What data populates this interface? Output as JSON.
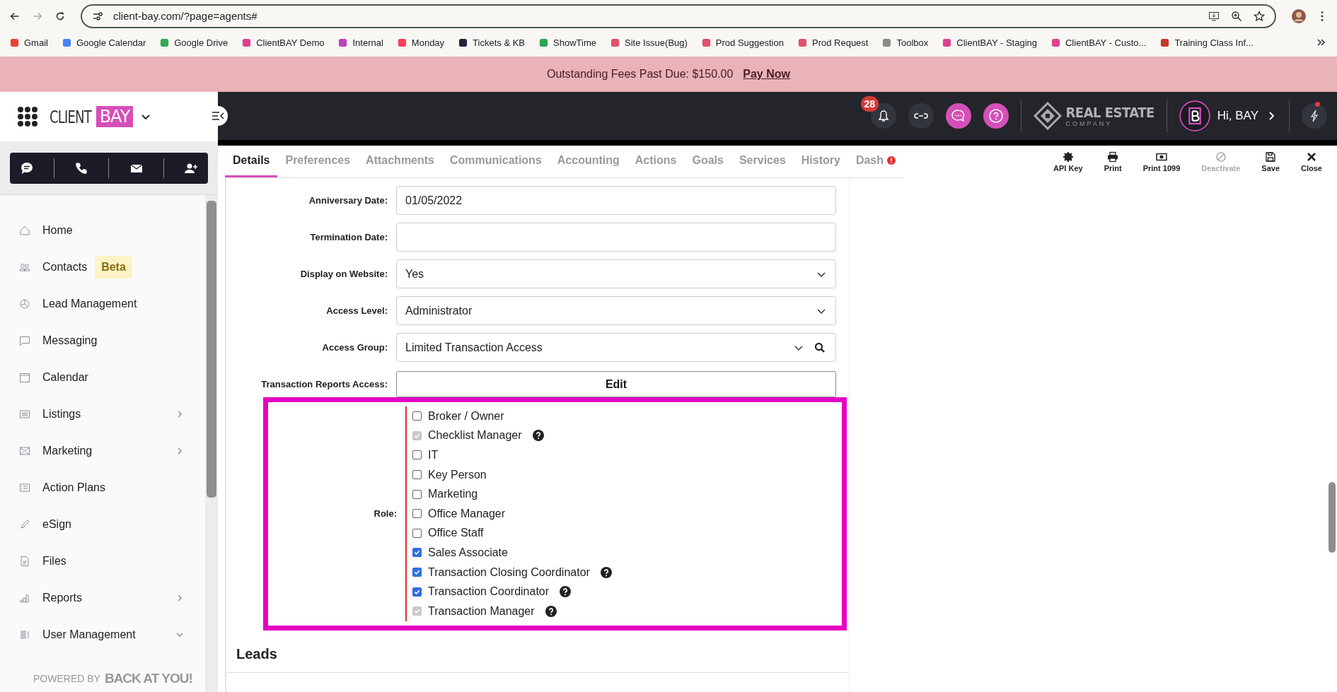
{
  "browser": {
    "url": "client-bay.com/?page=agents#",
    "bookmarks": [
      {
        "label": "Gmail",
        "color": "#ea4335"
      },
      {
        "label": "Google Calendar",
        "color": "#4285f4"
      },
      {
        "label": "Google Drive",
        "color": "#34a853"
      },
      {
        "label": "ClientBAY Demo",
        "color": "#e0408f"
      },
      {
        "label": "Internal",
        "color": "#c040c0"
      },
      {
        "label": "Monday",
        "color": "#ff3d57"
      },
      {
        "label": "Tickets & KB",
        "color": "#2a1f3d"
      },
      {
        "label": "ShowTime",
        "color": "#2ea44f"
      },
      {
        "label": "Site Issue(Bug)",
        "color": "#e0506a"
      },
      {
        "label": "Prod Suggestion",
        "color": "#e0506a"
      },
      {
        "label": "Prod Request",
        "color": "#e0506a"
      },
      {
        "label": "Toolbox",
        "color": "#8a8a8a"
      },
      {
        "label": "ClientBAY - Staging",
        "color": "#e0408f"
      },
      {
        "label": "ClientBAY - Custo...",
        "color": "#e0408f"
      },
      {
        "label": "Training Class Inf...",
        "color": "#c0392b"
      }
    ]
  },
  "banner": {
    "message": "Outstanding Fees Past Due: $150.00",
    "link": "Pay Now"
  },
  "logo": {
    "left": "CLIENT",
    "right": "BAY"
  },
  "sidebar": {
    "items": [
      {
        "label": "Home",
        "kind": "link"
      },
      {
        "label": "Contacts",
        "kind": "link",
        "badge": "Beta"
      },
      {
        "label": "Lead Management",
        "kind": "link"
      },
      {
        "label": "Messaging",
        "kind": "link"
      },
      {
        "label": "Calendar",
        "kind": "link"
      },
      {
        "label": "Listings",
        "kind": "group",
        "expanded": false
      },
      {
        "label": "Marketing",
        "kind": "group",
        "expanded": false
      },
      {
        "label": "Action Plans",
        "kind": "link"
      },
      {
        "label": "eSign",
        "kind": "link"
      },
      {
        "label": "Files",
        "kind": "link"
      },
      {
        "label": "Reports",
        "kind": "group",
        "expanded": false
      },
      {
        "label": "User Management",
        "kind": "group",
        "expanded": true
      }
    ],
    "powered_by": "POWERED BY",
    "powered_brand": "BACK AT YOU!"
  },
  "topbar": {
    "notifications": "28",
    "brand": "REAL ESTATE",
    "brand_sub": "COMPANY",
    "greeting": "Hi, BAY"
  },
  "tabs": [
    {
      "label": "Details",
      "selected": true
    },
    {
      "label": "Preferences",
      "selected": false
    },
    {
      "label": "Attachments",
      "selected": false
    },
    {
      "label": "Communications",
      "selected": false
    },
    {
      "label": "Accounting",
      "selected": false
    },
    {
      "label": "Actions",
      "selected": false
    },
    {
      "label": "Goals",
      "selected": false
    },
    {
      "label": "Services",
      "selected": false
    },
    {
      "label": "History",
      "selected": false
    },
    {
      "label": "Dash",
      "selected": false,
      "alert": true
    }
  ],
  "actions": [
    {
      "label": "API Key",
      "disabled": false
    },
    {
      "label": "Print",
      "disabled": false
    },
    {
      "label": "Print 1099",
      "disabled": false
    },
    {
      "label": "Deactivate",
      "disabled": true
    },
    {
      "label": "Save",
      "disabled": false
    },
    {
      "label": "Close",
      "disabled": false
    }
  ],
  "form": {
    "fields": [
      {
        "label": "Anniversary Date:",
        "kind": "text",
        "value": "01/05/2022"
      },
      {
        "label": "Termination Date:",
        "kind": "text"
      },
      {
        "label": "Display on Website:",
        "kind": "select",
        "value": "Yes"
      },
      {
        "label": "Access Level:",
        "kind": "select",
        "value": "Administrator"
      },
      {
        "label": "Access Group:",
        "kind": "lookup",
        "value": "Limited Transaction Access"
      },
      {
        "label": "Transaction Reports Access:",
        "kind": "button",
        "value": "Edit"
      }
    ],
    "role_label": "Role:",
    "roles": [
      {
        "label": "Broker / Owner",
        "checked": false,
        "disabled": false,
        "help": false
      },
      {
        "label": "Checklist Manager",
        "checked": true,
        "disabled": true,
        "help": true
      },
      {
        "label": "IT",
        "checked": false,
        "disabled": false,
        "help": false
      },
      {
        "label": "Key Person",
        "checked": false,
        "disabled": false,
        "help": false
      },
      {
        "label": "Marketing",
        "checked": false,
        "disabled": false,
        "help": false
      },
      {
        "label": "Office Manager",
        "checked": false,
        "disabled": false,
        "help": false
      },
      {
        "label": "Office Staff",
        "checked": false,
        "disabled": false,
        "help": false
      },
      {
        "label": "Sales Associate",
        "checked": true,
        "disabled": false,
        "help": false
      },
      {
        "label": "Transaction Closing Coordinator",
        "checked": true,
        "disabled": false,
        "help": true
      },
      {
        "label": "Transaction Coordinator",
        "checked": true,
        "disabled": false,
        "help": true
      },
      {
        "label": "Transaction Manager",
        "checked": true,
        "disabled": true,
        "help": true
      }
    ]
  },
  "leads_heading": "Leads"
}
